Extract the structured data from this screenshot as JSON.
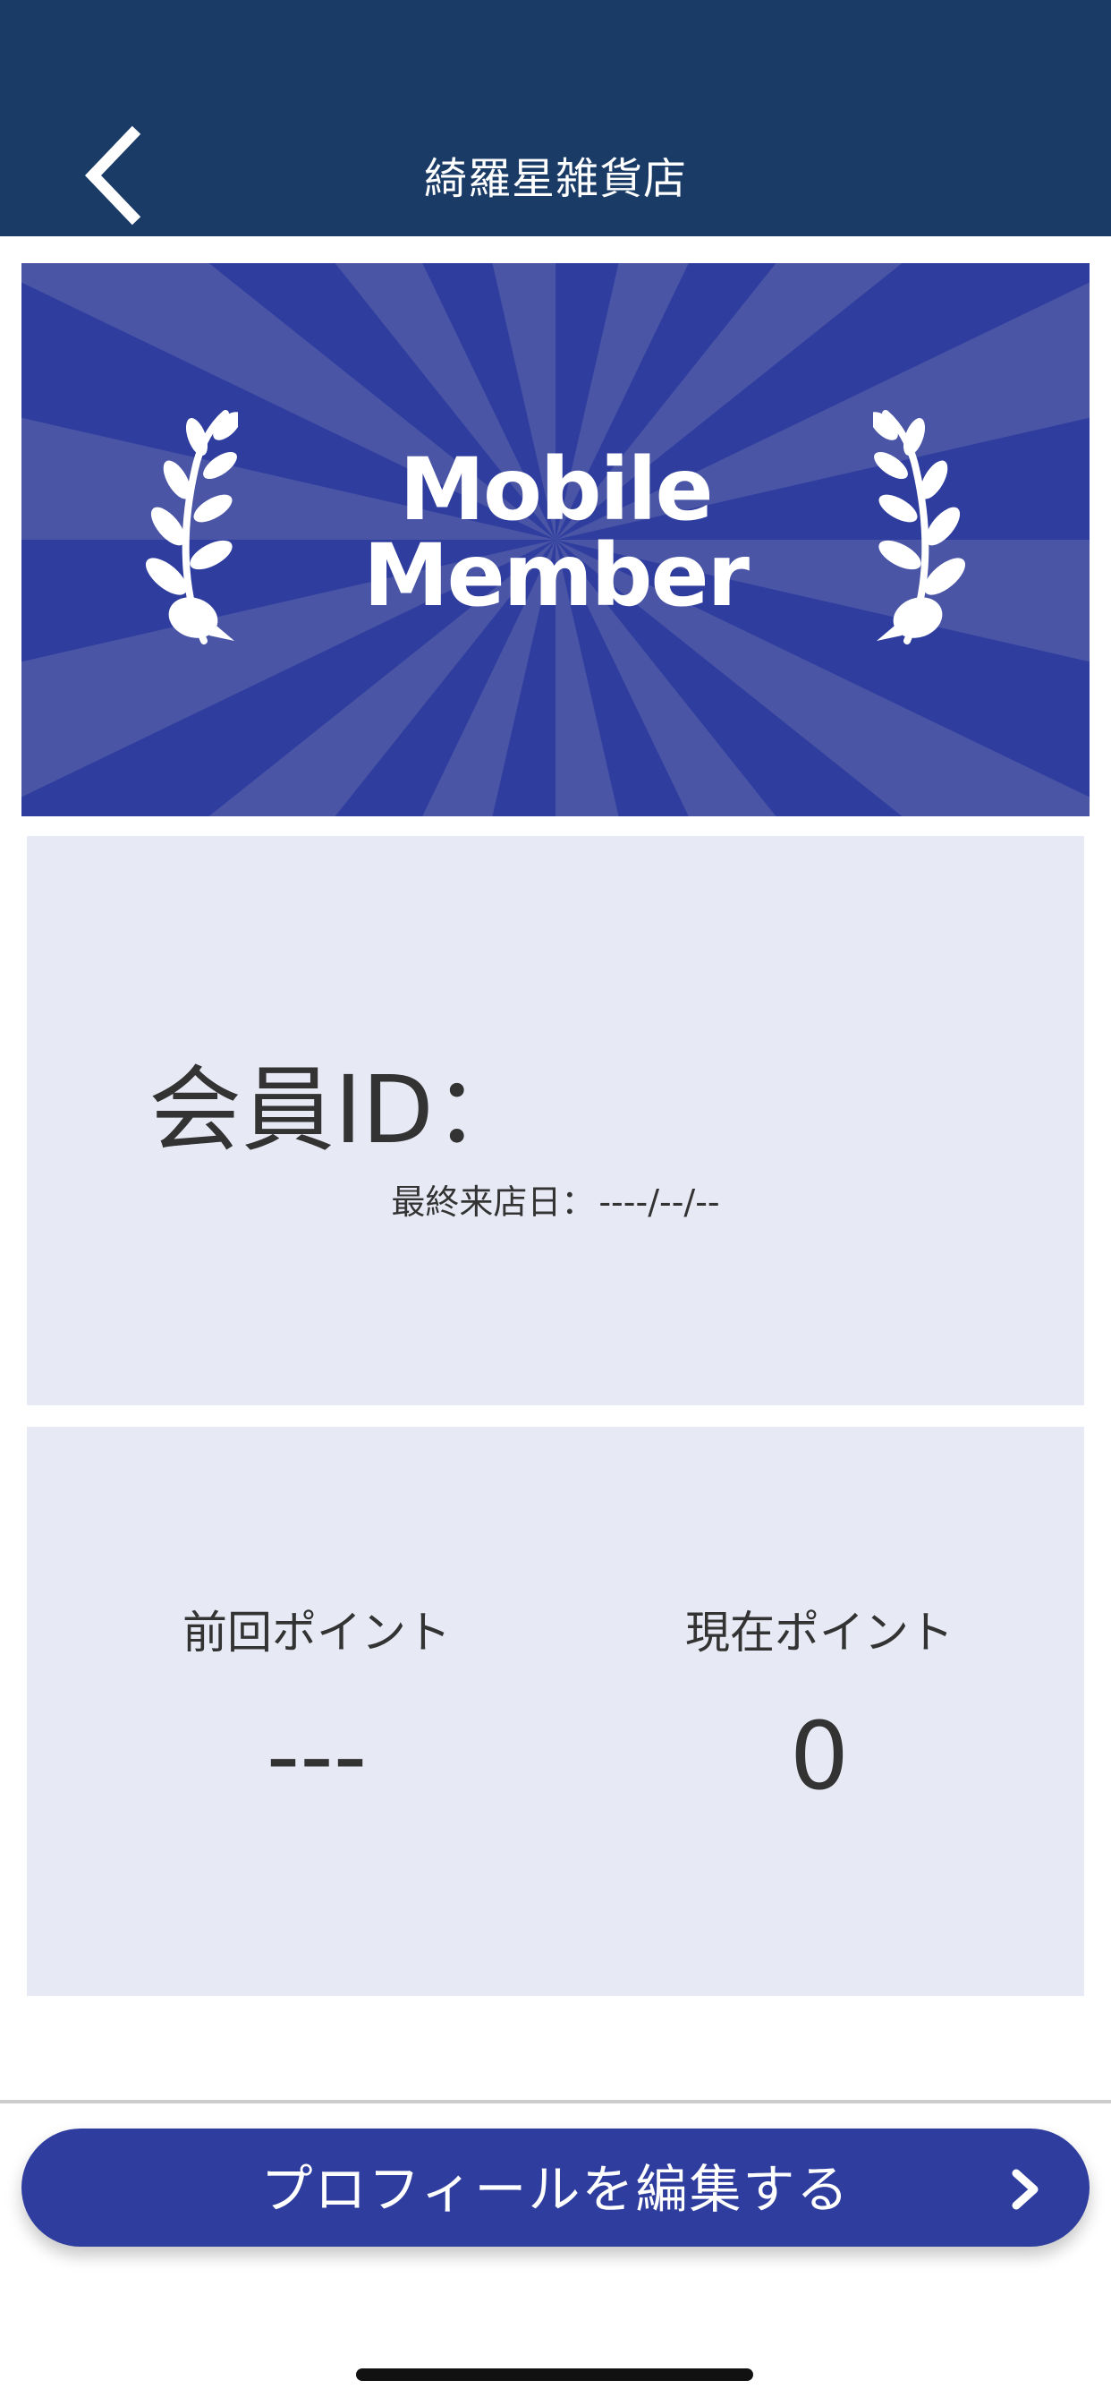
{
  "header": {
    "title": "綺羅星雑貨店",
    "back_icon": "chevron-left-icon",
    "background": "#1a3b66"
  },
  "banner": {
    "line1": "Mobile",
    "line2": "Member",
    "background": "#2f3e9e",
    "ray_color": "#4a55a6",
    "icons": [
      "laurel-icon",
      "laurel-icon"
    ]
  },
  "member_card": {
    "id_label": "会員ID：",
    "last_visit_label": "最終来店日：",
    "last_visit_value": "----/--/--",
    "background": "#e7e9f5"
  },
  "points": {
    "previous_label": "前回ポイント",
    "previous_value": "---",
    "current_label": "現在ポイント",
    "current_value": "0"
  },
  "footer": {
    "edit_profile_label": "プロフィールを編集する",
    "edit_icon": "chevron-right-icon",
    "button_color": "#2f3e9e"
  }
}
